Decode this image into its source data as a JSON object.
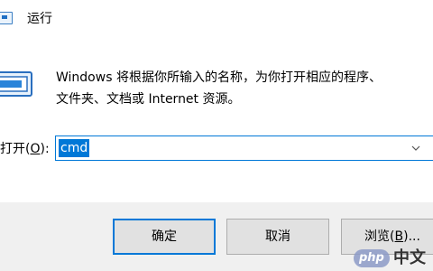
{
  "dialog": {
    "title": "运行",
    "description_lines": [
      "Windows 将根据你所输入的名称，为你打开相应的程序、",
      "文件夹、文档或 Internet 资源。"
    ],
    "open_label": {
      "prefix": "打开(",
      "accel": "O",
      "suffix": "):"
    },
    "open_value": "cmd",
    "buttons": {
      "ok": "确定",
      "cancel": "取消",
      "browse": {
        "prefix": "浏览(",
        "accel": "B",
        "suffix": ")..."
      }
    }
  },
  "watermark": {
    "badge": "php",
    "text": "中文"
  },
  "colors": {
    "accent": "#0078d7",
    "footer_bg": "#f0f0f0",
    "button_bg": "#e1e1e1"
  },
  "icons": [
    "run-app-icon",
    "run-dialog-icon",
    "chevron-down-icon"
  ]
}
